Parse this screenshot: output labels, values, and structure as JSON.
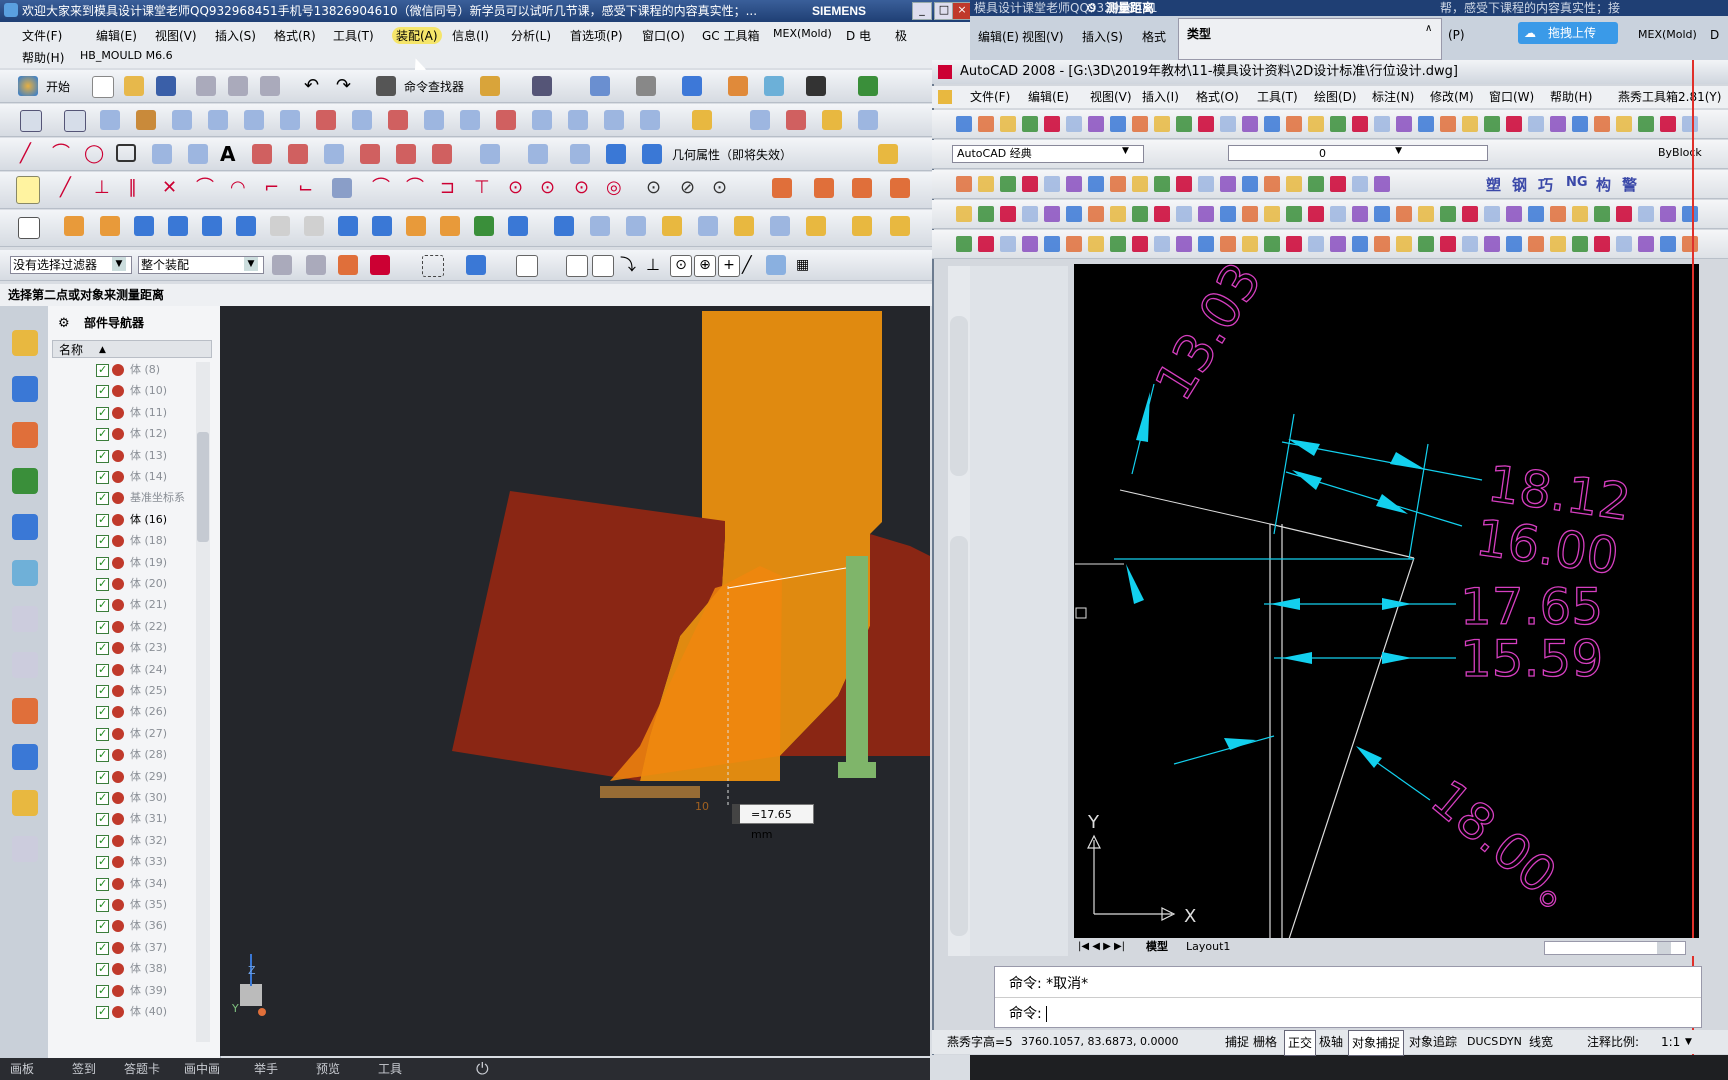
{
  "nx": {
    "title": "欢迎大家来到模具设计课堂老师QQ932968451手机号13826904610（微信同号）新学员可以试听几节课，感受下课程的内容真实性；...",
    "brand": "SIEMENS",
    "menu_row1": [
      "文件(F)",
      "编辑(E)",
      "视图(V)",
      "插入(S)",
      "格式(R)",
      "工具(T)",
      "装配(A)",
      "信息(I)",
      "分析(L)",
      "首选项(P)",
      "窗口(O)",
      "GC 工具箱",
      "MEX(Mold)",
      "D 电",
      "极"
    ],
    "menu_row2": [
      "帮助(H)",
      "HB_MOULD M6.6"
    ],
    "toolbar": {
      "start": "开始",
      "command_finder": "命令查找器",
      "geometry_props": "几何属性（即将失效）"
    },
    "filter": {
      "selection_filter": "没有选择过滤器",
      "scope": "整个装配"
    },
    "status_prompt": "选择第二点或对象来测量距离",
    "navigator": {
      "title": "部件导航器",
      "column": "名称",
      "rows": [
        "体 (8)",
        "体 (10)",
        "体 (11)",
        "体 (12)",
        "体 (13)",
        "体 (14)",
        "基准坐标系",
        "体 (16)",
        "体 (18)",
        "体 (19)",
        "体 (20)",
        "体 (21)",
        "体 (22)",
        "体 (23)",
        "体 (24)",
        "体 (25)",
        "体 (26)",
        "体 (27)",
        "体 (28)",
        "体 (29)",
        "体 (30)",
        "体 (31)",
        "体 (32)",
        "体 (33)",
        "体 (34)",
        "体 (35)",
        "体 (36)",
        "体 (37)",
        "体 (38)",
        "体 (39)",
        "体 (40)"
      ]
    },
    "measure_readout": "=17.65 mm",
    "measure_ruler_label": "10",
    "bottom_bar": [
      "画板",
      "签到",
      "答题卡",
      "画中画",
      "举手",
      "预览",
      "工具"
    ],
    "axis_labels": {
      "y": "Y",
      "z": "Z"
    }
  },
  "top3": {
    "title": "模具设计课堂老师QQ932968451",
    "dialog_title": "测量距离",
    "type_label": "类型",
    "menu": [
      "编辑(E)",
      "视图(V)",
      "插入(S)",
      "格式"
    ],
    "upload_btn": "拖拽上传",
    "menu_right": [
      "(P)",
      "MEX(Mold)",
      "D"
    ],
    "title_right": "帮，感受下课程的内容真实性；接"
  },
  "autocad": {
    "title": "AutoCAD 2008 - [G:\\3D\\2019年教材\\11-模具设计资料\\2D设计标准\\行位设计.dwg]",
    "menu": [
      "文件(F)",
      "编辑(E)",
      "视图(V)",
      "插入(I)",
      "格式(O)",
      "工具(T)",
      "绘图(D)",
      "标注(N)",
      "修改(M)",
      "窗口(W)",
      "帮助(H)",
      "燕秀工具箱2.81(Y)"
    ],
    "workspace": "AutoCAD 经典",
    "layer": "0",
    "linetype": "ByBlock",
    "tb_chars": [
      "塑",
      "钢",
      "巧",
      "NG",
      "构",
      "警"
    ],
    "dims": [
      "13.03",
      "18.12",
      "16.00",
      "17.65",
      "15.59",
      "18.00。"
    ],
    "ucs": {
      "x": "X",
      "y": "Y"
    },
    "tabs": [
      "模型",
      "Layout1"
    ],
    "cmd_lines": [
      "命令: *取消*",
      "命令: "
    ],
    "status": {
      "prefix": "燕秀字高=5",
      "coords": "3760.1057, 83.6873, 0.0000",
      "buttons": [
        "捕捉",
        "栅格",
        "正交",
        "极轴",
        "对象捕捉",
        "对象追踪",
        "DUCS",
        "DYN",
        "线宽"
      ],
      "scale_label": "注释比例:",
      "scale_value": "1:1"
    }
  },
  "colors": {
    "dim_magenta": "#d63fc0",
    "dim_cyan": "#13d0ee",
    "part_orange": "#e07d10",
    "part_red": "#8a2614",
    "pin_green": "#7fb56a"
  }
}
